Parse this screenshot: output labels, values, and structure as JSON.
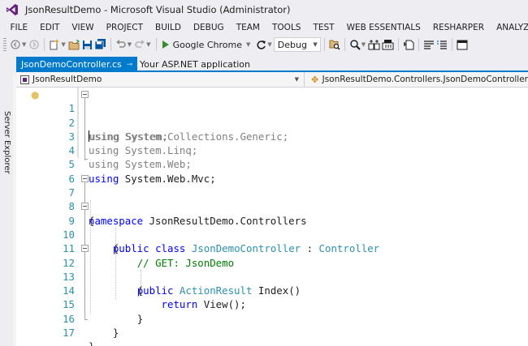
{
  "window": {
    "title": "JsonResultDemo - Microsoft Visual Studio (Administrator)"
  },
  "menu": [
    "FILE",
    "EDIT",
    "VIEW",
    "PROJECT",
    "BUILD",
    "DEBUG",
    "TEAM",
    "TOOLS",
    "TEST",
    "WEB ESSENTIALS",
    "RESHARPER",
    "ANALYZE"
  ],
  "toolbar": {
    "run_target": "Google Chrome",
    "configuration": "Debug"
  },
  "side_panel": {
    "label": "Server Explorer"
  },
  "tabs": [
    {
      "label": "JsonDemoController.cs",
      "active": true
    },
    {
      "label": "Your ASP.NET application",
      "active": false
    }
  ],
  "navbar": {
    "project": "JsonResultDemo",
    "class_path": "JsonResultDemo.Controllers.JsonDemoController"
  },
  "code": {
    "line_numbers": [
      "1",
      "2",
      "3",
      "4",
      "5",
      "6",
      "7",
      "8",
      "9",
      "10",
      "11",
      "12",
      "13",
      "14",
      "15",
      "16",
      "17"
    ],
    "l1_kw": "using",
    "l1_rest": " System;",
    "l2_kw": "using",
    "l2_rest": " System.Collections.Generic;",
    "l3_kw": "using",
    "l3_rest": " System.Linq;",
    "l4_kw": "using",
    "l4_rest": " System.Web;",
    "l5_kw": "using",
    "l5_rest": " System.Web.Mvc;",
    "l7_kw": "namespace",
    "l7_rest": " JsonResultDemo.Controllers",
    "l8": "{",
    "l9_kw1": "public",
    "l9_kw2": "class",
    "l9_type": "JsonDemoController",
    "l9_colon": " : ",
    "l9_base": "Controller",
    "l10": "{",
    "l11": "// GET: JsonDemo",
    "l12_kw": "public",
    "l12_type": "ActionResult",
    "l12_rest": " Index()",
    "l13": "{",
    "l14_kw": "return",
    "l14_rest": " View();",
    "l15": "}",
    "l16": "}",
    "l17": "}"
  },
  "colors": {
    "accent": "#007acc",
    "keyword": "#0000ff",
    "type": "#2b91af",
    "comment": "#008000",
    "unused_using": "#808080"
  }
}
